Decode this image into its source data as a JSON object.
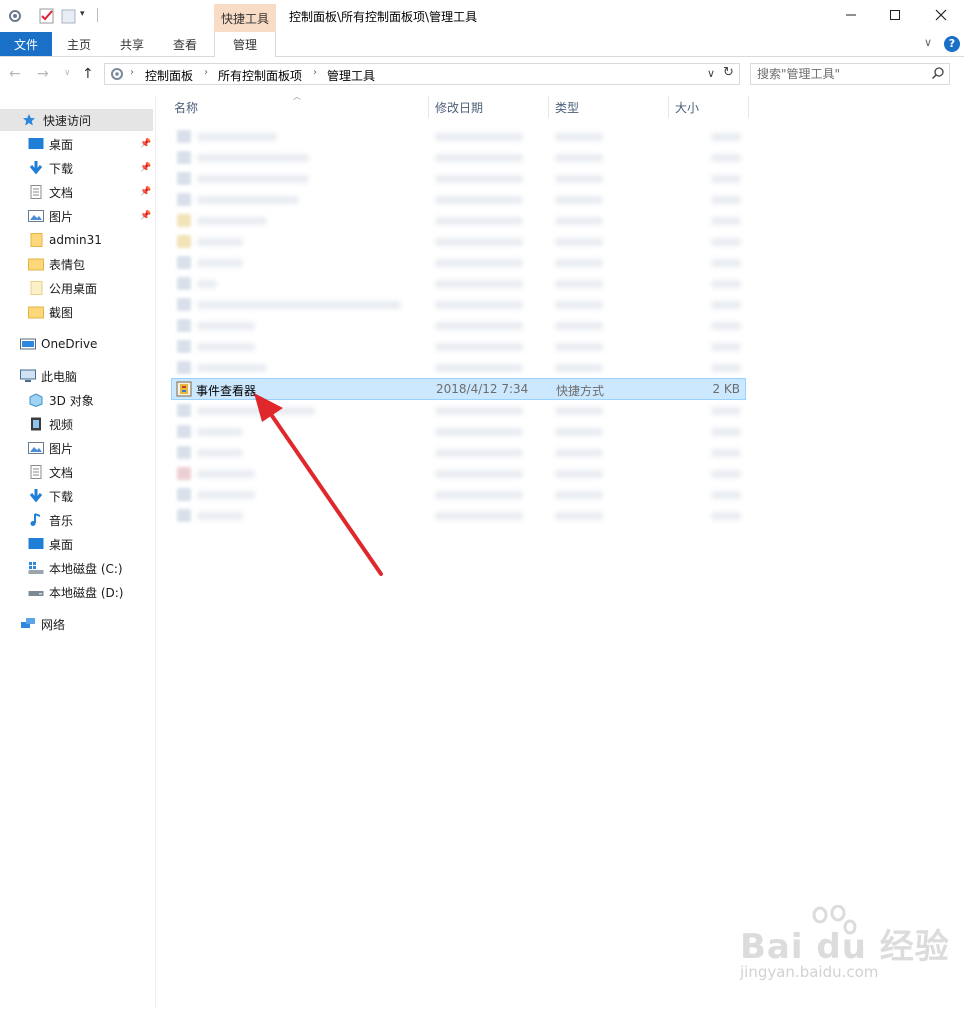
{
  "window": {
    "title": "控制面板\\所有控制面板项\\管理工具",
    "context_tab_group": "快捷工具"
  },
  "ribbon": {
    "tabs": [
      "文件",
      "主页",
      "共享",
      "查看",
      "管理"
    ]
  },
  "address": {
    "crumbs": [
      "控制面板",
      "所有控制面板项",
      "管理工具"
    ]
  },
  "search": {
    "placeholder": "搜索\"管理工具\""
  },
  "sidebar": {
    "quick_access": "快速访问",
    "quick_items": [
      "桌面",
      "下载",
      "文档",
      "图片",
      "admin31",
      "表情包",
      "公用桌面",
      "截图"
    ],
    "onedrive": "OneDrive",
    "this_pc": "此电脑",
    "pc_items": [
      "3D 对象",
      "视频",
      "图片",
      "文档",
      "下载",
      "音乐",
      "桌面",
      "本地磁盘 (C:)",
      "本地磁盘 (D:)"
    ],
    "network": "网络"
  },
  "columns": [
    "名称",
    "修改日期",
    "类型",
    "大小"
  ],
  "selected_file": {
    "name": "事件查看器",
    "date": "2018/4/12 7:34",
    "type": "快捷方式",
    "size": "2 KB"
  },
  "watermark": {
    "main": "Bai du 经验",
    "sub": "jingyan.baidu.com"
  },
  "colors": {
    "file_tab": "#1a6fc6",
    "context_tab": "#f9dcc6",
    "selection_bg": "#cce8ff",
    "selection_border": "#99d1ff",
    "arrow": "#e0282c"
  }
}
